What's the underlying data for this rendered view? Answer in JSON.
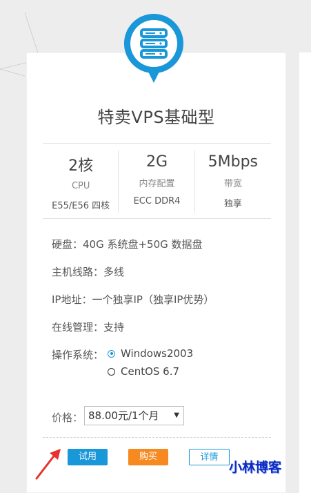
{
  "product": {
    "title": "特卖VPS基础型",
    "icon": "server-icon",
    "accent_color": "#1a97d9"
  },
  "specs": [
    {
      "value": "2核",
      "label": "CPU",
      "sub": "E55/E56 四核"
    },
    {
      "value": "2G",
      "label": "内存配置",
      "sub": "ECC DDR4"
    },
    {
      "value": "5Mbps",
      "label": "带宽",
      "sub": "独享"
    }
  ],
  "details": {
    "disk": "硬盘：40G 系统盘+50G 数据盘",
    "line": "主机线路：多线",
    "ip": "IP地址：一个独享IP（独享IP优势）",
    "management": "在线管理：支持",
    "os_label": "操作系统："
  },
  "os_options": [
    {
      "label": "Windows2003",
      "checked": true
    },
    {
      "label": "CentOS 6.7",
      "checked": false
    }
  ],
  "price": {
    "label": "价格：",
    "selected": "88.00元/1个月"
  },
  "buttons": {
    "trial": "试用",
    "buy": "购买",
    "detail": "详情",
    "trial_color": "#1a97d9",
    "buy_color": "#f6891f"
  },
  "watermark": "小林博客",
  "annotation_color": "#e8322b"
}
